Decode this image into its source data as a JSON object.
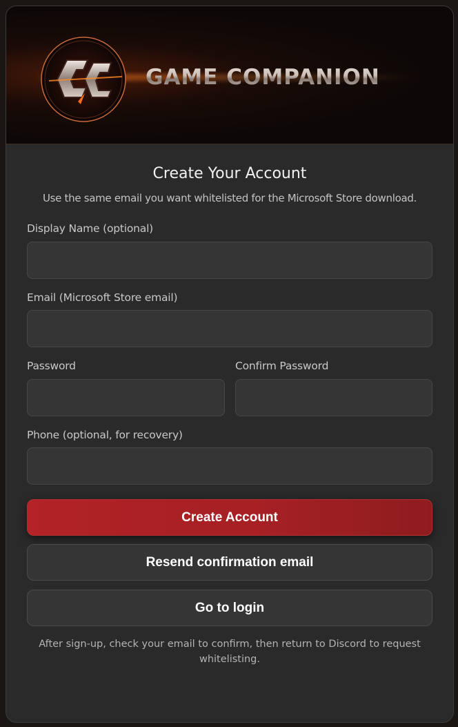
{
  "brand": {
    "logo_icon": "gc-emblem-icon",
    "name": "GAME COMPANION"
  },
  "form": {
    "title": "Create Your Account",
    "subtitle": "Use the same email you want whitelisted for the Microsoft Store download.",
    "display_name": {
      "label": "Display Name (optional)",
      "value": ""
    },
    "email": {
      "label": "Email (Microsoft Store email)",
      "value": ""
    },
    "password": {
      "label": "Password",
      "value": ""
    },
    "confirm_password": {
      "label": "Confirm Password",
      "value": ""
    },
    "phone": {
      "label": "Phone (optional, for recovery)",
      "value": ""
    }
  },
  "actions": {
    "create": "Create Account",
    "resend": "Resend confirmation email",
    "login": "Go to login"
  },
  "footnote": "After sign-up, check your email to confirm, then return to Discord to request whitelisting.",
  "colors": {
    "primary": "#b22226",
    "background": "#2a2a2a",
    "accent_glow": "#ff7a1e"
  }
}
